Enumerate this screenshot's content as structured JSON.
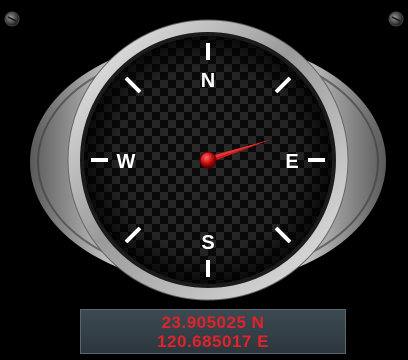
{
  "compass": {
    "labels": {
      "north": "N",
      "east": "E",
      "south": "S",
      "west": "W"
    },
    "heading_degrees": 72,
    "needle_color": "#d41818",
    "face_checker_colors": [
      "#262626",
      "#0a0a0a"
    ],
    "bezel_color": "#cfcfcf",
    "icons": {
      "left_screw": "screw-icon",
      "right_screw": "screw-icon"
    }
  },
  "location": {
    "latitude": "23.905025 N",
    "longitude": "120.685017 E",
    "text_color": "#e0222a"
  }
}
